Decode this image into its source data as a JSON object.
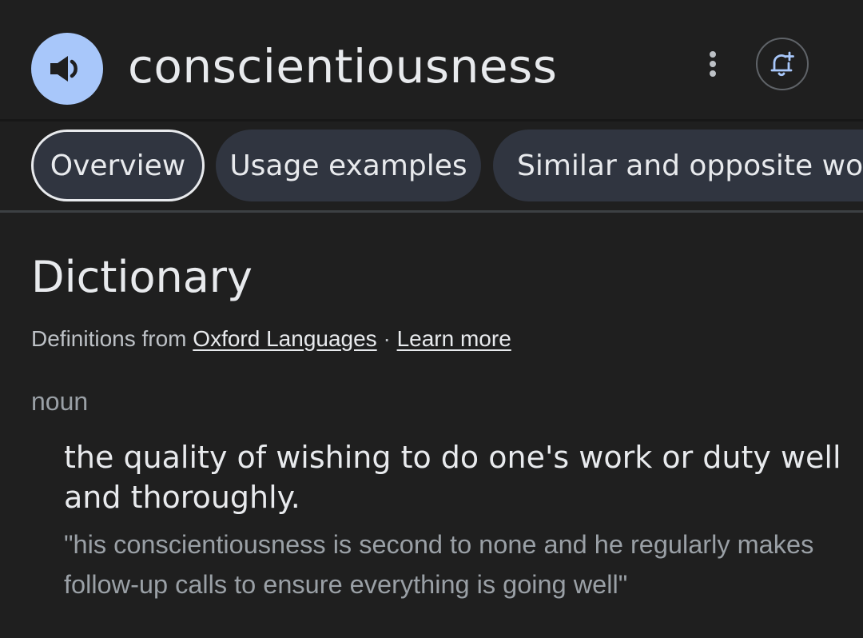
{
  "header": {
    "word": "conscientiousness",
    "speaker_icon": "speaker-icon",
    "more_icon": "more-vert-icon",
    "alert_icon": "add-alert-icon"
  },
  "tabs": [
    {
      "label": "Overview",
      "active": true
    },
    {
      "label": "Usage examples",
      "active": false
    },
    {
      "label": "Similar and opposite words",
      "active": false
    }
  ],
  "dictionary": {
    "title": "Dictionary",
    "source_prefix": "Definitions from",
    "source_link": "Oxford Languages",
    "separator": "·",
    "learn_more": "Learn more",
    "part_of_speech": "noun",
    "definition": "the quality of wishing to do one's work or duty well and thoroughly.",
    "example": "\"his conscientiousness is second to none and he regularly makes follow-up calls to ensure everything is going well\""
  },
  "colors": {
    "background": "#1f1f1f",
    "speaker_button": "#a8c7fa",
    "tab_background": "#303540",
    "text_primary": "#e8eaed",
    "text_secondary": "#9aa0a6"
  }
}
